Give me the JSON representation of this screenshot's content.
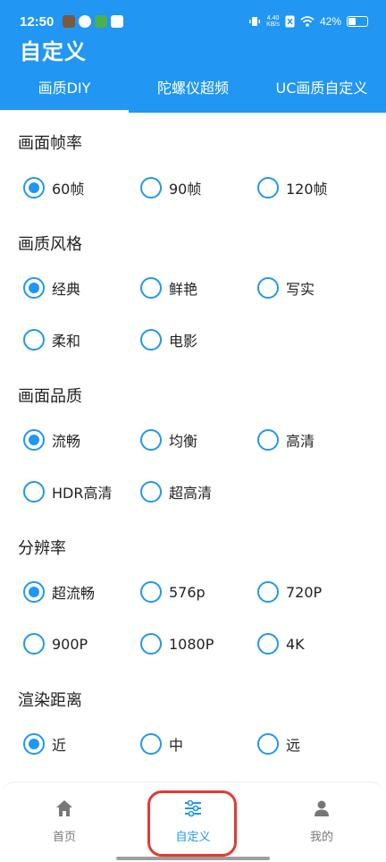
{
  "status_bar": {
    "time": "12:50",
    "net_speed_top": "4.40",
    "net_speed_bottom": "KB/s",
    "battery": "42%",
    "battery_level": 0.42
  },
  "app_title": "自定义",
  "tabs": [
    {
      "label": "画质DIY",
      "active": true
    },
    {
      "label": "陀螺仪超频",
      "active": false
    },
    {
      "label": "UC画质自定义",
      "active": false
    }
  ],
  "groups": [
    {
      "title": "画面帧率",
      "options": [
        {
          "label": "60帧",
          "checked": true
        },
        {
          "label": "90帧",
          "checked": false
        },
        {
          "label": "120帧",
          "checked": false
        }
      ]
    },
    {
      "title": "画质风格",
      "options": [
        {
          "label": "经典",
          "checked": true
        },
        {
          "label": "鲜艳",
          "checked": false
        },
        {
          "label": "写实",
          "checked": false
        },
        {
          "label": "柔和",
          "checked": false
        },
        {
          "label": "电影",
          "checked": false
        }
      ]
    },
    {
      "title": "画面品质",
      "options": [
        {
          "label": "流畅",
          "checked": true
        },
        {
          "label": "均衡",
          "checked": false
        },
        {
          "label": "高清",
          "checked": false
        },
        {
          "label": "HDR高清",
          "checked": false
        },
        {
          "label": "超高清",
          "checked": false
        }
      ]
    },
    {
      "title": "分辨率",
      "options": [
        {
          "label": "超流畅",
          "checked": true
        },
        {
          "label": "576p",
          "checked": false
        },
        {
          "label": "720P",
          "checked": false
        },
        {
          "label": "900P",
          "checked": false
        },
        {
          "label": "1080P",
          "checked": false
        },
        {
          "label": "4K",
          "checked": false
        }
      ]
    },
    {
      "title": "渲染距离",
      "options": [
        {
          "label": "近",
          "checked": true
        },
        {
          "label": "中",
          "checked": false
        },
        {
          "label": "远",
          "checked": false
        }
      ]
    }
  ],
  "bottom_nav": [
    {
      "label": "首页",
      "icon": "home-icon",
      "active": false
    },
    {
      "label": "自定义",
      "icon": "sliders-icon",
      "active": true
    },
    {
      "label": "我的",
      "icon": "person-icon",
      "active": false
    }
  ],
  "colors": {
    "primary": "#2196f3",
    "highlight": "#e53935"
  }
}
